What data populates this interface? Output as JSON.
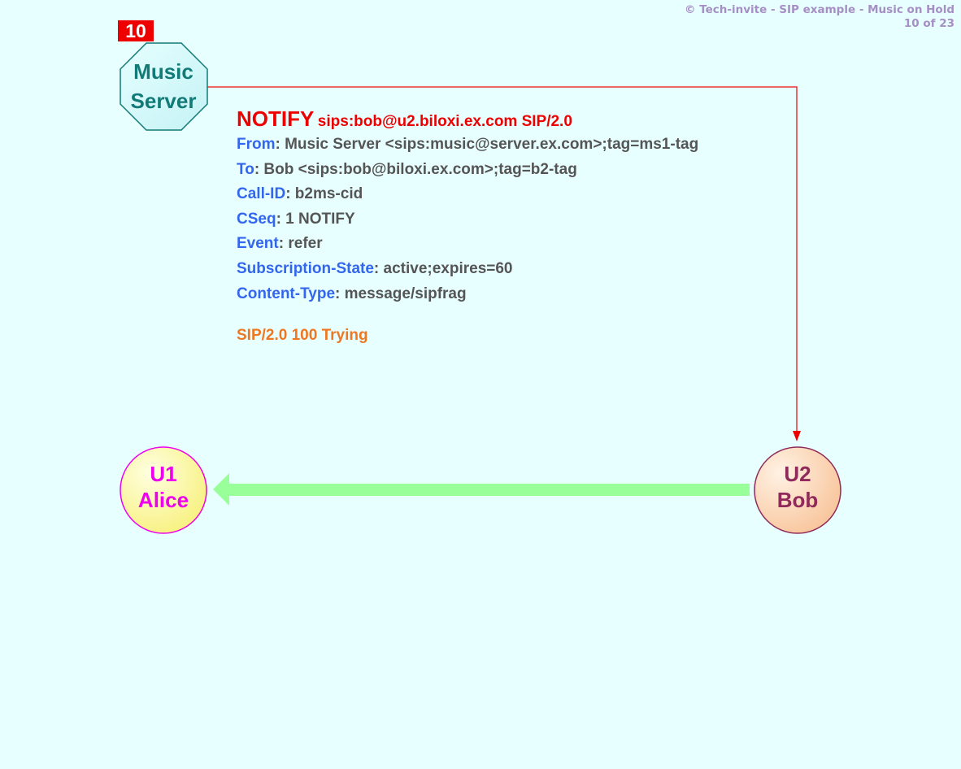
{
  "header": {
    "copyright": "© Tech-invite - SIP example - Music on Hold",
    "page": "10 of 23"
  },
  "step": "10",
  "nodes": {
    "music_server": {
      "line1": "Music",
      "line2": "Server"
    },
    "alice": {
      "line1": "U1",
      "line2": "Alice"
    },
    "bob": {
      "line1": "U2",
      "line2": "Bob"
    }
  },
  "message": {
    "method": "NOTIFY",
    "request_uri": "sips:bob@u2.biloxi.ex.com SIP/2.0",
    "headers": [
      {
        "name": "From",
        "value": ": Music Server <sips:music@server.ex.com>;tag=ms1-tag"
      },
      {
        "name": "To",
        "value": ": Bob <sips:bob@biloxi.ex.com>;tag=b2-tag"
      },
      {
        "name": "Call-ID",
        "value": ": b2ms-cid"
      },
      {
        "name": "CSeq",
        "value": ": 1 NOTIFY"
      },
      {
        "name": "Event",
        "value": ": refer"
      },
      {
        "name": "Subscription-State",
        "value": ": active;expires=60"
      },
      {
        "name": "Content-Type",
        "value": ": message/sipfrag"
      }
    ],
    "body": "SIP/2.0 100 Trying"
  },
  "colors": {
    "background": "#e8ffff",
    "signal_arrow": "#ee0000",
    "media_arrow": "#99ff99",
    "header_name": "#3366ee",
    "header_value": "#555555",
    "body": "#ee7722"
  }
}
